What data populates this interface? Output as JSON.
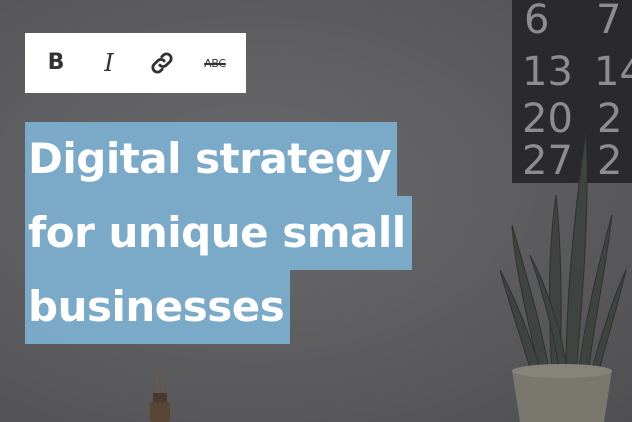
{
  "toolbar": {
    "bold_label": "B",
    "italic_label": "I",
    "link_icon": "link-icon",
    "strike_label": "ABC"
  },
  "heading": {
    "lines": [
      "Digital strategy",
      "for unique small",
      "businesses"
    ]
  },
  "background": {
    "calendar_numbers": [
      "6",
      "7",
      "13",
      "14",
      "20",
      "2",
      "27",
      "2"
    ]
  },
  "colors": {
    "selection": "#7baecc",
    "toolbar_bg": "#ffffff",
    "wall": "#5c5c5f"
  }
}
